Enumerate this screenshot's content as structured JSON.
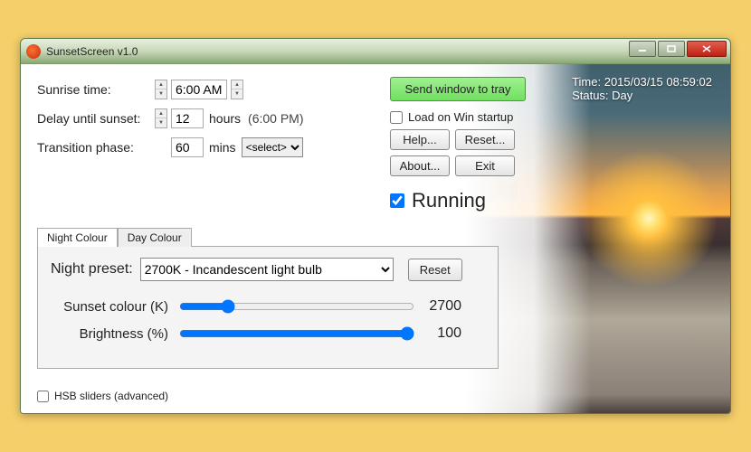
{
  "window": {
    "title": "SunsetScreen v1.0"
  },
  "status": {
    "time_line": "Time: 2015/03/15 08:59:02",
    "status_line": "Status: Day"
  },
  "settings": {
    "sunrise_label": "Sunrise time:",
    "sunrise_value": "6:00 AM",
    "delay_label": "Delay until sunset:",
    "delay_value": "12",
    "delay_unit": "hours",
    "delay_resolved": "(6:00 PM)",
    "transition_label": "Transition phase:",
    "transition_value": "60",
    "transition_unit": "mins",
    "transition_select": "<select>"
  },
  "actions": {
    "tray": "Send window to tray",
    "load_startup": "Load on Win startup",
    "help": "Help...",
    "reset": "Reset...",
    "about": "About...",
    "exit": "Exit",
    "running": "Running"
  },
  "tabs": {
    "night": "Night Colour",
    "day": "Day Colour"
  },
  "night_panel": {
    "preset_label": "Night preset:",
    "preset_value": "2700K - Incandescent light bulb",
    "reset": "Reset",
    "colour_label": "Sunset colour (K)",
    "colour_value": "2700",
    "brightness_label": "Brightness (%)",
    "brightness_value": "100"
  },
  "hsb_label": "HSB sliders (advanced)"
}
